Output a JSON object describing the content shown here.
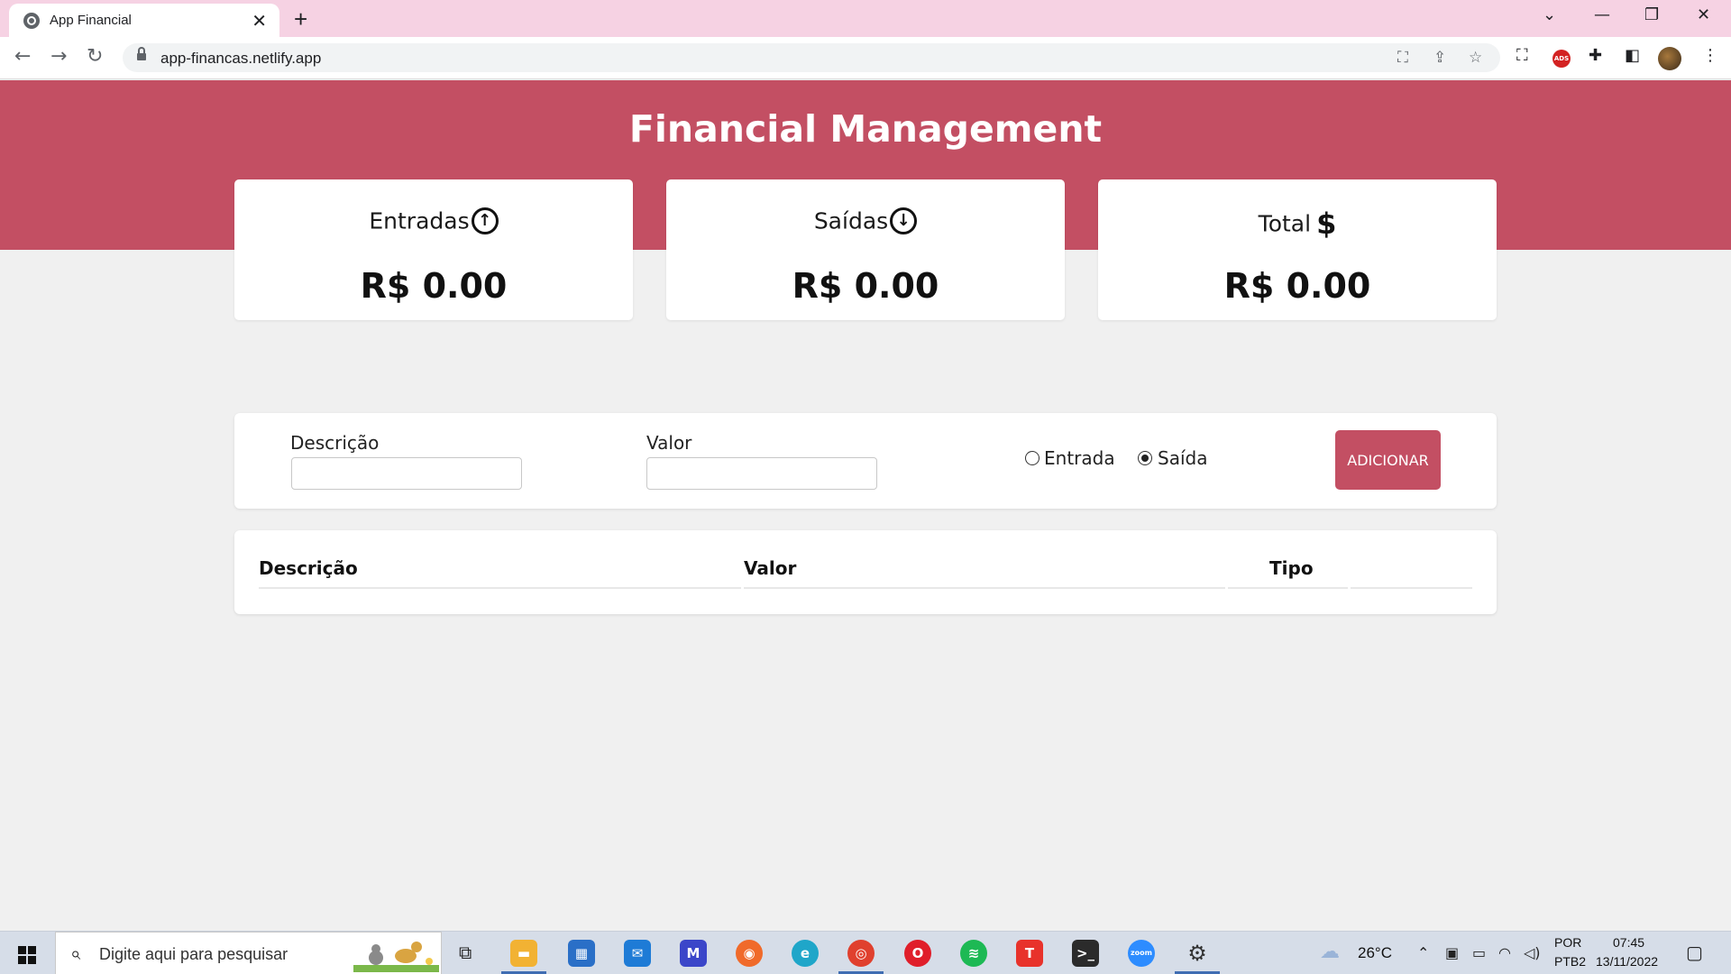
{
  "browser": {
    "tab_title": "App Financial",
    "url": "app-financas.netlify.app",
    "ads_label": "ADS"
  },
  "page": {
    "title": "Financial Management",
    "cards": [
      {
        "label": "Entradas",
        "value": "R$ 0.00",
        "icon": "arrow-up-circle-icon"
      },
      {
        "label": "Saídas",
        "value": "R$ 0.00",
        "icon": "arrow-down-circle-icon"
      },
      {
        "label": "Total",
        "value": "R$ 0.00",
        "icon": "dollar-icon"
      }
    ],
    "form": {
      "description_label": "Descrição",
      "description_value": "",
      "value_label": "Valor",
      "value_value": "",
      "radio_entrada": "Entrada",
      "radio_saida": "Saída",
      "selected": "Saída",
      "add_button": "ADICIONAR"
    },
    "table": {
      "headers": [
        "Descrição",
        "Valor",
        "Tipo"
      ]
    },
    "accent_color": "#c34f63"
  },
  "taskbar": {
    "search_placeholder": "Digite aqui para pesquisar",
    "weather": "26°C",
    "language": "POR",
    "keyboard": "PTB2",
    "time": "07:45",
    "date": "13/11/2022",
    "zoom_label": "zoom"
  }
}
